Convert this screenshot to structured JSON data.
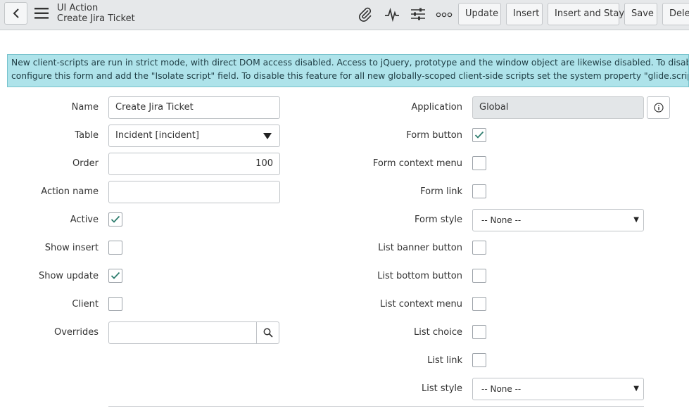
{
  "header": {
    "record_type": "UI Action",
    "record_name": "Create Jira Ticket",
    "buttons": {
      "update": "Update",
      "insert": "Insert",
      "insert_and_stay": "Insert and Stay",
      "save": "Save",
      "delete": "Delet"
    },
    "icons": [
      "back-icon",
      "hamburger-menu-icon",
      "paperclip-icon",
      "activity-pulse-icon",
      "sliders-icon",
      "more-options-icon"
    ]
  },
  "alert": {
    "line1": "New client-scripts are run in strict mode, with direct DOM access disabled. Access to jQuery, prototype and the window object are likewise disabled. To disable this on a per-script b",
    "line2": "configure this form and add the \"Isolate script\" field. To disable this feature for all new globally-scoped client-side scripts set the system property \"glide.script.block.client.globals\""
  },
  "form_left": {
    "name_label": "Name",
    "name_value": "Create Jira Ticket",
    "table_label": "Table",
    "table_value": "Incident [incident]",
    "order_label": "Order",
    "order_value": "100",
    "action_name_label": "Action name",
    "action_name_value": "",
    "active_label": "Active",
    "active_checked": true,
    "show_insert_label": "Show insert",
    "show_insert_checked": false,
    "show_update_label": "Show update",
    "show_update_checked": true,
    "client_label": "Client",
    "client_checked": false,
    "overrides_label": "Overrides",
    "overrides_value": ""
  },
  "form_right": {
    "application_label": "Application",
    "application_value": "Global",
    "form_button_label": "Form button",
    "form_button_checked": true,
    "form_context_menu_label": "Form context menu",
    "form_context_menu_checked": false,
    "form_link_label": "Form link",
    "form_link_checked": false,
    "form_style_label": "Form style",
    "form_style_value": "-- None --",
    "list_banner_button_label": "List banner button",
    "list_banner_button_checked": false,
    "list_bottom_button_label": "List bottom button",
    "list_bottom_button_checked": false,
    "list_context_menu_label": "List context menu",
    "list_context_menu_checked": false,
    "list_choice_label": "List choice",
    "list_choice_checked": false,
    "list_link_label": "List link",
    "list_link_checked": false,
    "list_style_label": "List style",
    "list_style_value": "-- None --"
  },
  "colors": {
    "header_bg": "#e6e8ea",
    "alert_bg": "#aee3ea",
    "alert_border": "#78c3cd",
    "check_color": "#2e7d6e"
  }
}
